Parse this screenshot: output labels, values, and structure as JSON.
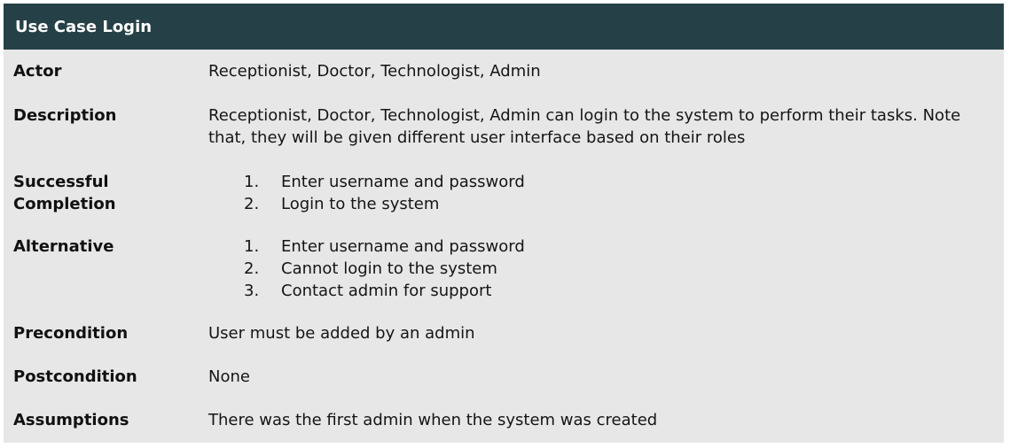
{
  "header": {
    "title": "Use Case Login"
  },
  "rows": {
    "actor": {
      "label": "Actor",
      "value": "Receptionist, Doctor, Technologist, Admin"
    },
    "description": {
      "label": "Description",
      "value": "Receptionist, Doctor, Technologist, Admin can login to the system to perform their tasks. Note that, they will be given different user interface based on their roles"
    },
    "successful_completion": {
      "label": "Successful Completion",
      "steps": [
        {
          "num": "1.",
          "text": "Enter username and password"
        },
        {
          "num": "2.",
          "text": "Login to the system"
        }
      ]
    },
    "alternative": {
      "label": "Alternative",
      "steps": [
        {
          "num": "1.",
          "text": "Enter username and password"
        },
        {
          "num": "2.",
          "text": "Cannot login to the system"
        },
        {
          "num": "3.",
          "text": "Contact admin for support"
        }
      ]
    },
    "precondition": {
      "label": "Precondition",
      "value": "User must be added by an admin"
    },
    "postcondition": {
      "label": "Postcondition",
      "value": "None"
    },
    "assumptions": {
      "label": "Assumptions",
      "value": "There was the first admin when the system was created"
    }
  },
  "colors": {
    "header_bg": "#264047",
    "header_text": "#ffffff",
    "body_bg": "#e7e7e7"
  }
}
